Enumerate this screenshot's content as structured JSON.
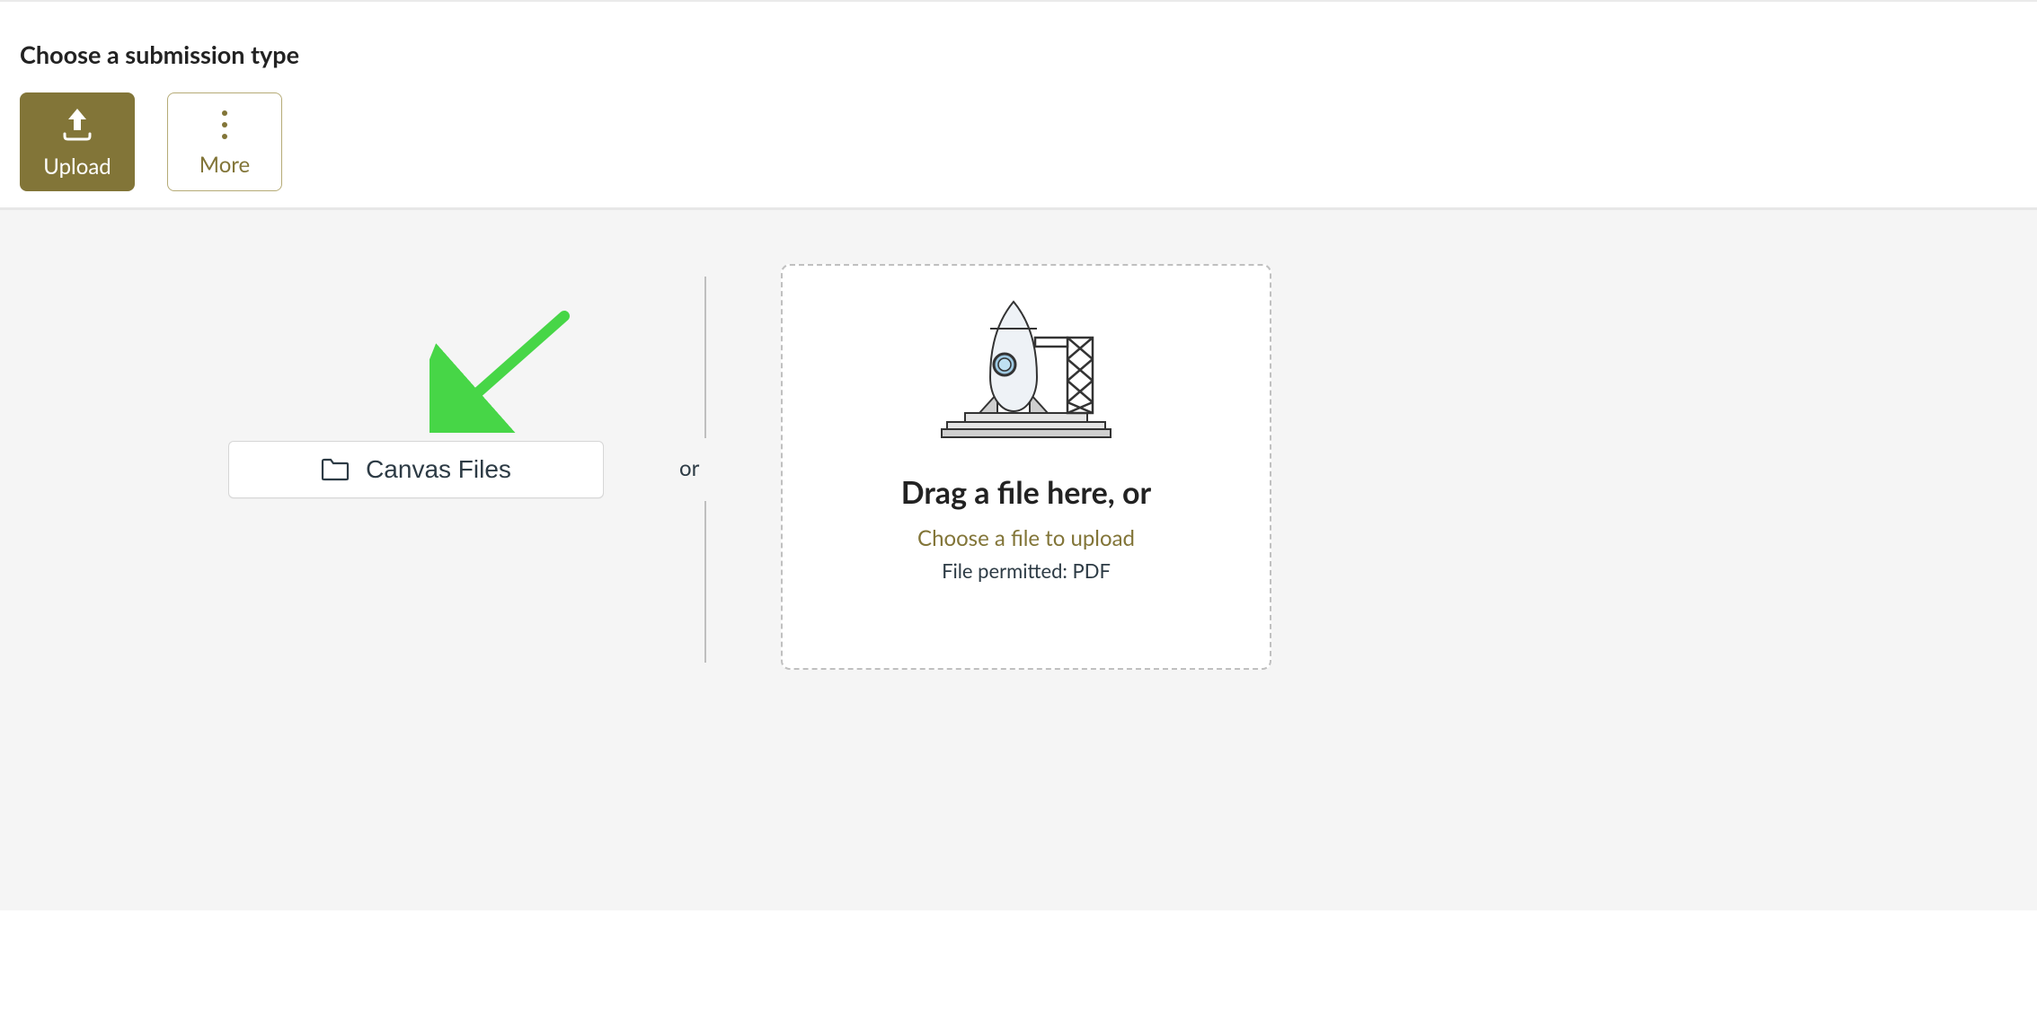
{
  "section_title": "Choose a submission type",
  "tabs": {
    "upload_label": "Upload",
    "more_label": "More"
  },
  "canvas_files_button": "Canvas Files",
  "separator_label": "or",
  "dropzone": {
    "headline": "Drag a file here, or",
    "choose_label": "Choose a file to upload",
    "permitted_label": "File permitted: PDF"
  },
  "annotation": {
    "arrow_color": "#47d647"
  }
}
